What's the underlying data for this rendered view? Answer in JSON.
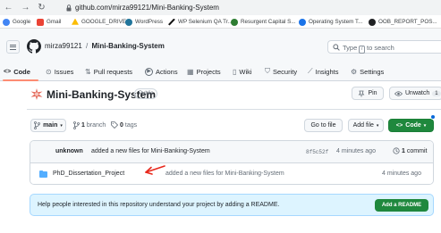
{
  "browser": {
    "url": "github.com/mirza99121/Mini-Banking-System",
    "back_glyph": "←",
    "forward_glyph": "→",
    "reload_glyph": "↻"
  },
  "bookmarks": [
    {
      "label": "Google",
      "icon": "google-icon",
      "color": "#4285f4"
    },
    {
      "label": "Gmail",
      "icon": "gmail-icon",
      "color": "#ea4335"
    },
    {
      "label": "GOOGLE_DRIVE",
      "icon": "google-drive-icon",
      "color": "#fbbc04"
    },
    {
      "label": "WordPress",
      "icon": "wordpress-icon",
      "color": "#21759b"
    },
    {
      "label": "WP Selenium QA Tr...",
      "icon": "feather-icon",
      "color": "#111111"
    },
    {
      "label": "Resurgent Capital S...",
      "icon": "resurgent-icon",
      "color": "#2e7d32"
    },
    {
      "label": "Operating System T...",
      "icon": "globe-icon",
      "color": "#1a73e8"
    },
    {
      "label": "OOB_REPORT_POS...",
      "icon": "report-icon",
      "color": "#202124"
    }
  ],
  "header": {
    "owner": "mirza99121",
    "separator": "/",
    "repo": "Mini-Banking-System",
    "search_prefix": "Type",
    "search_key": "/",
    "search_suffix": "to search"
  },
  "tabs": [
    {
      "label": "Code",
      "icon": "code-icon",
      "glyph": "<>",
      "selected": true
    },
    {
      "label": "Issues",
      "icon": "issue-icon",
      "glyph": "⊙"
    },
    {
      "label": "Pull requests",
      "icon": "pull-request-icon",
      "glyph": "⇅"
    },
    {
      "label": "Actions",
      "icon": "actions-icon",
      "glyph": "▶"
    },
    {
      "label": "Projects",
      "icon": "projects-icon",
      "glyph": "▦"
    },
    {
      "label": "Wiki",
      "icon": "wiki-icon",
      "glyph": "▯"
    },
    {
      "label": "Security",
      "icon": "shield-icon",
      "glyph": "⛉"
    },
    {
      "label": "Insights",
      "icon": "graph-icon",
      "glyph": "⟋"
    },
    {
      "label": "Settings",
      "icon": "gear-icon",
      "glyph": "⚙"
    }
  ],
  "repo": {
    "name": "Mini-Banking-System",
    "visibility": "Public",
    "pin_label": "Pin",
    "watch_label": "Unwatch",
    "watch_count": "1"
  },
  "branch": {
    "name": "main",
    "branch_count": "1",
    "branch_label": "branch",
    "tag_count": "0",
    "tag_label": "tags",
    "go_to_file": "Go to file",
    "add_file": "Add file",
    "code_label": "Code"
  },
  "commit": {
    "author": "unknown",
    "message": "added a new files for Mini-Banking-System",
    "hash": "8f5c52f",
    "time": "4 minutes ago",
    "count": "1",
    "count_label": "commit"
  },
  "files": [
    {
      "name": "PhD_Dissertation_Project",
      "message": "added a new files for Mini-Banking-System",
      "time": "4 minutes ago",
      "icon": "folder-icon"
    }
  ],
  "readme": {
    "text": "Help people interested in this repository understand your project by adding a README.",
    "button": "Add a README"
  },
  "colors": {
    "accent_green": "#1f883d",
    "folder_blue": "#54aeff",
    "annotation_red": "#e8281c",
    "tab_underline": "#fd8c73"
  }
}
